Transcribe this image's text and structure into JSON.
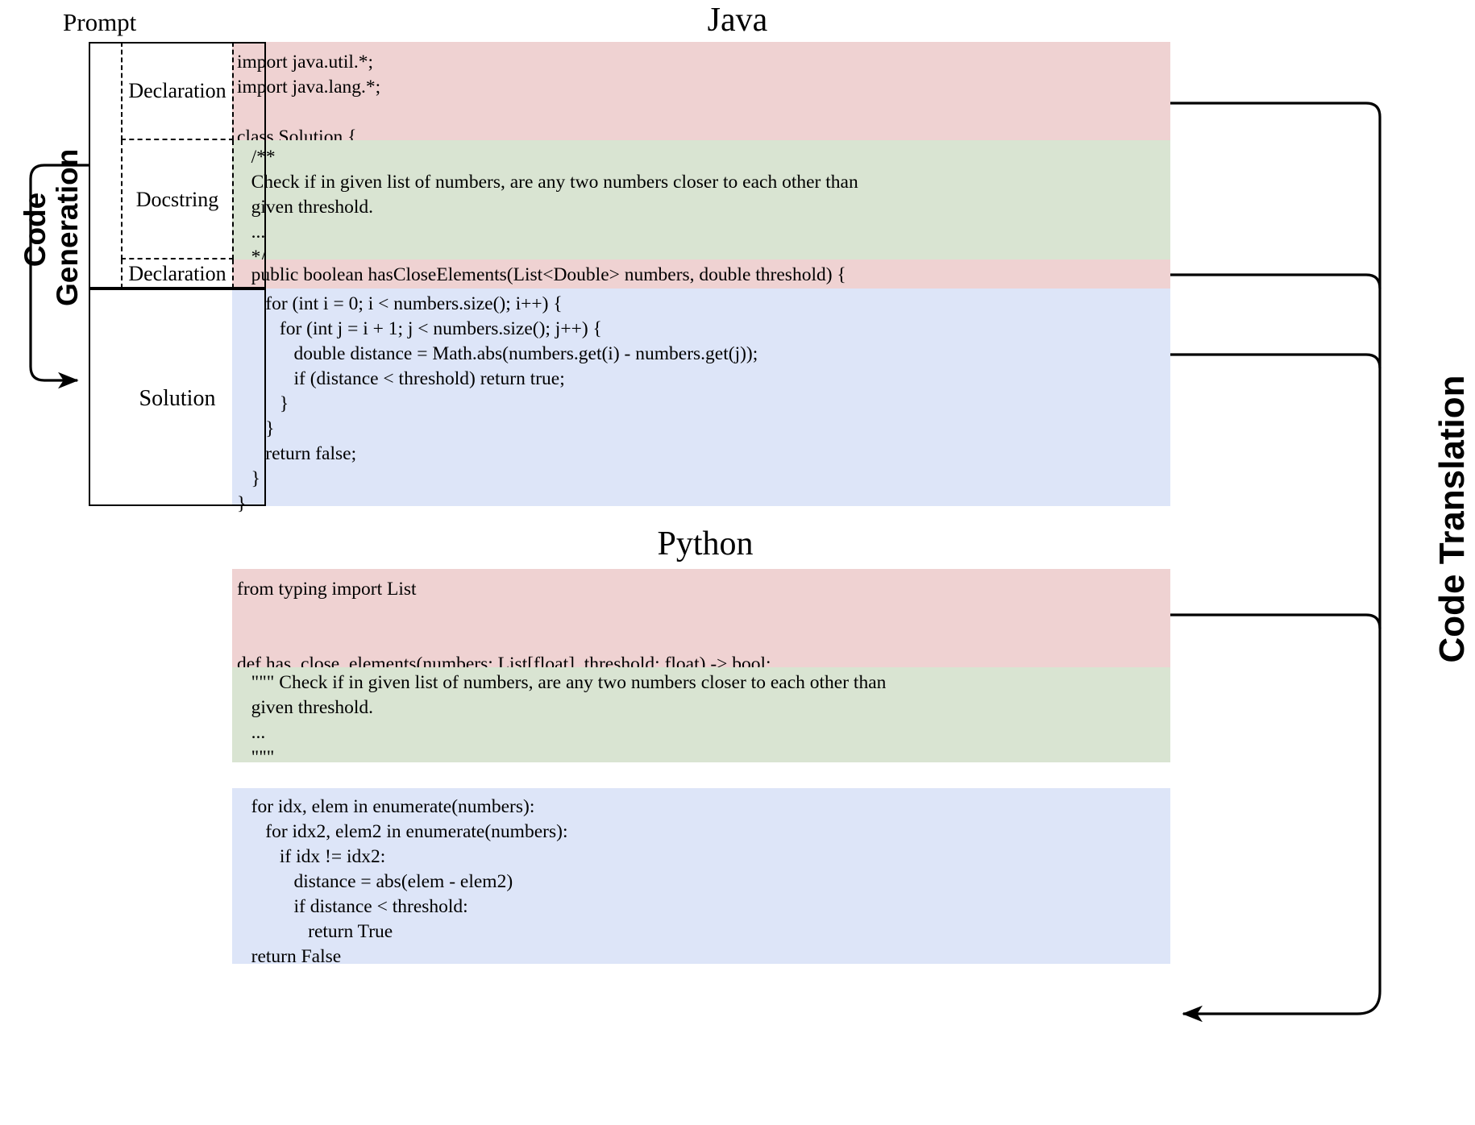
{
  "figure": {
    "left_process_label": "Code\nGeneration",
    "right_process_label": "Code Translation",
    "prompt_caption": "Prompt"
  },
  "java": {
    "title": "Java",
    "segments": {
      "declaration_top": "import java.util.*;\nimport java.lang.*;\n\nclass Solution {",
      "docstring": "   /**\n   Check if in given list of numbers, are any two numbers closer to each other than\n   given threshold.\n   ...\n   */",
      "declaration_method": "   public boolean hasCloseElements(List<Double> numbers, double threshold) {",
      "solution": "      for (int i = 0; i < numbers.size(); i++) {\n         for (int j = i + 1; j < numbers.size(); j++) {\n            double distance = Math.abs(numbers.get(i) - numbers.get(j));\n            if (distance < threshold) return true;\n         }\n      }\n      return false;\n   }\n}"
    },
    "box_labels": {
      "declaration_1": "Declaration",
      "docstring": "Docstring",
      "declaration_2": "Declaration",
      "solution": "Solution"
    }
  },
  "python": {
    "title": "Python",
    "segments": {
      "declaration": "from typing import List\n\n\ndef has_close_elements(numbers: List[float], threshold: float) -> bool:",
      "docstring": "   \"\"\" Check if in given list of numbers, are any two numbers closer to each other than\n   given threshold.\n   ...\n   \"\"\"",
      "solution": "   for idx, elem in enumerate(numbers):\n      for idx2, elem2 in enumerate(numbers):\n         if idx != idx2:\n            distance = abs(elem - elem2)\n            if distance < threshold:\n               return True\n   return False"
    }
  },
  "colors": {
    "declaration_bg": "#efd2d2",
    "docstring_bg": "#d9e4d2",
    "solution_bg": "#dde5f8",
    "line": "#000000",
    "background": "#ffffff"
  }
}
